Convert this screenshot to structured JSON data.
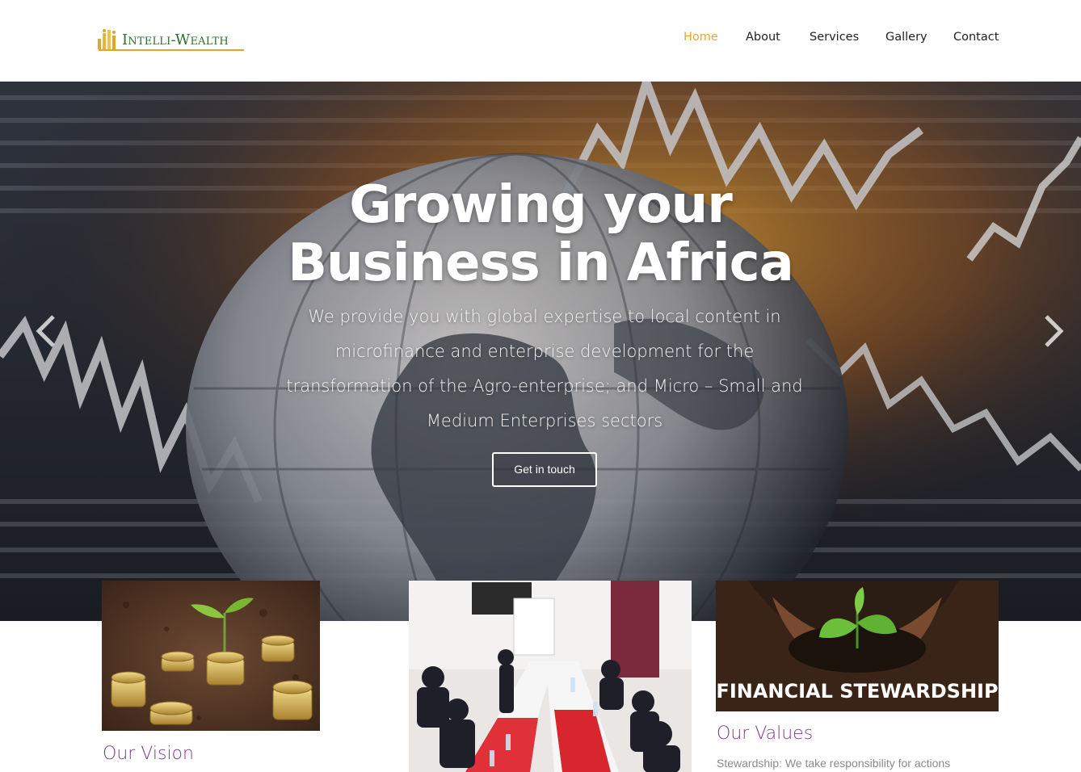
{
  "brand": {
    "name": "Intelli-Wealth"
  },
  "nav": {
    "items": [
      "Home",
      "About",
      "Services",
      "Gallery",
      "Contact"
    ],
    "active": "Home"
  },
  "hero": {
    "title_line1": "Growing your",
    "title_line2": "Business in Africa",
    "subtitle": "We provide you with global expertise to local content in microfinance and enterprise development for the transformation of the Agro-enterprise;  and Micro – Small and Medium Enterprises sectors",
    "cta": "Get in touch",
    "prev_icon": "chevron-left-icon",
    "next_icon": "chevron-right-icon"
  },
  "cards": [
    {
      "title": "Our Vision",
      "text": ""
    },
    {
      "title": "",
      "text": ""
    },
    {
      "title": "Our Values",
      "text": "Stewardship: We take responsibility for actions",
      "image_caption": "FINANCIAL STEWARDSHIP"
    }
  ],
  "colors": {
    "accent": "#e6a732",
    "nav_text": "#222222",
    "card_title": "#7d3c8c",
    "logo_green": "#2f6f2a"
  }
}
